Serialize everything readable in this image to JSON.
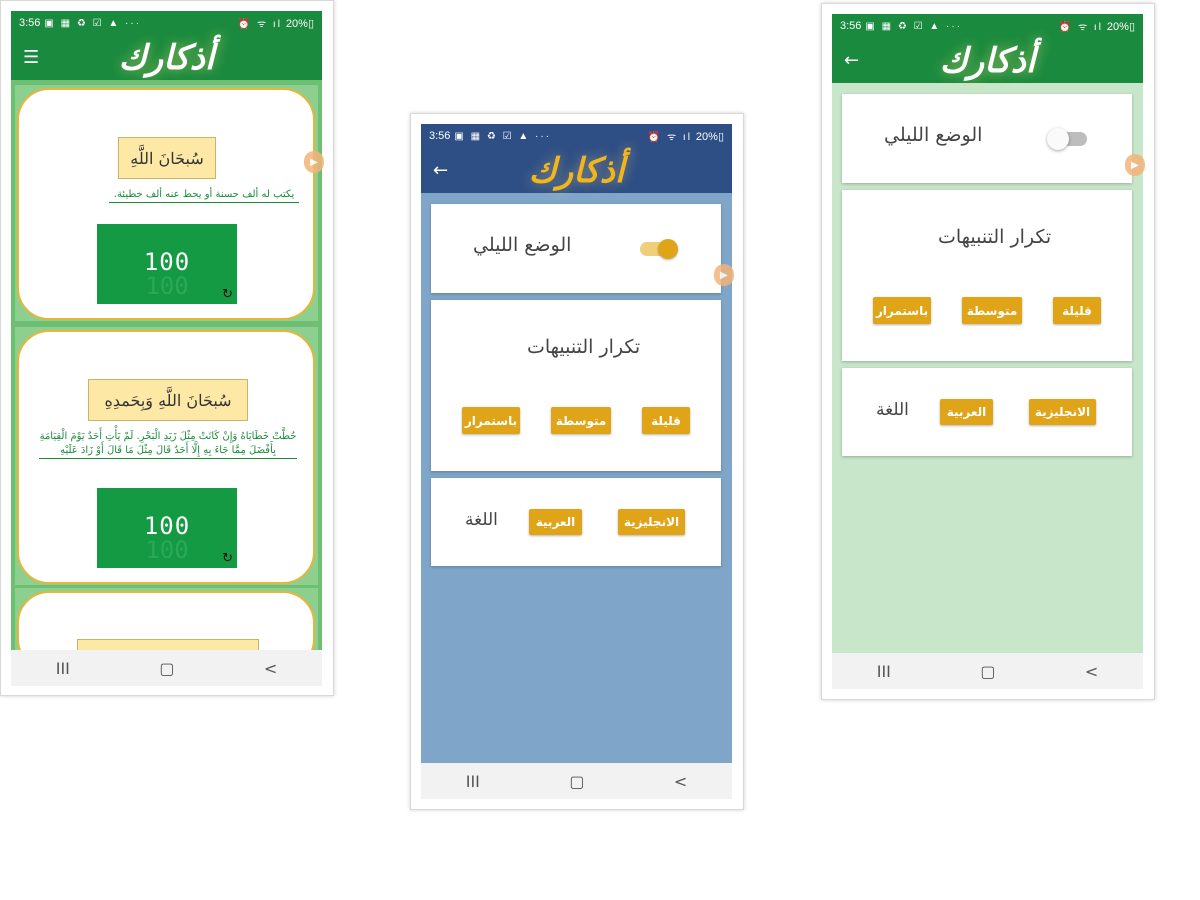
{
  "app": {
    "logo_text": "أذكارك"
  },
  "status_bar": {
    "time": "3:56",
    "icons": "▣ ▦ ♻ ☑ ▲ ···",
    "right_icons": "⏰ ᯤ ıl",
    "battery": "20%▯"
  },
  "screens": {
    "home": {
      "theme": "green",
      "appbar_color": "#1a8a3e",
      "menu_icon": "☰",
      "cards": [
        {
          "title": "سُبحَانَ اللَّهِ",
          "description": "يكتب له ألف حسنة أو يحط عنه ألف خطيئة.",
          "count": "100",
          "count_ghost": "100"
        },
        {
          "title": "سُبحَانَ اللَّهِ وَبِحَمدِهِ",
          "description": "حُطَّتْ خَطَايَاهُ وَإِنْ كَانَتْ مِثْلَ زَبَدِ الْبَحْرِ. لَمْ يَأْتِ أَحَدٌ يَوْمَ الْقِيَامَةِ بِأَفْضَلَ مِمَّا جَاءَ بِهِ إِلَّا أَحَدٌ قَالَ مِثْلَ مَا قَالَ أَوْ زَادَ عَلَيْهِ",
          "count": "100",
          "count_ghost": "100"
        }
      ]
    },
    "settings_dark": {
      "theme": "blue",
      "appbar_color": "#2e4f86",
      "background": "#7fa6c9",
      "night_mode_label": "الوضع الليلي",
      "night_mode_on": true,
      "alerts_label": "تكرار التنبيهات",
      "alert_options": [
        "قليلة",
        "متوسطة",
        "باستمرار"
      ],
      "language_label": "اللغة",
      "language_options": [
        "الانجليزية",
        "العربية"
      ]
    },
    "settings_light": {
      "theme": "green",
      "appbar_color": "#1a8a3e",
      "background": "#c8e6c9",
      "night_mode_label": "الوضع الليلي",
      "night_mode_on": false,
      "alerts_label": "تكرار التنبيهات",
      "alert_options": [
        "قليلة",
        "متوسطة",
        "باستمرار"
      ],
      "language_label": "اللغة",
      "language_options": [
        "الانجليزية",
        "العربية"
      ]
    }
  },
  "nav": {
    "recents": "III",
    "home": "▢",
    "back": "<"
  },
  "back_icon": "←",
  "reset_icon": "↻",
  "side_tab_icon": "▶"
}
